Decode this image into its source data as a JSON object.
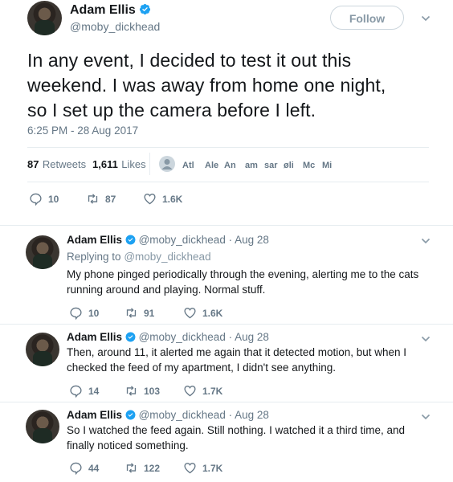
{
  "main_tweet": {
    "name": "Adam Ellis",
    "handle": "@moby_dickhead",
    "follow_label": "Follow",
    "text_lines": [
      "In any event, I decided to test it out this",
      "weekend. I was away from home one night,",
      "so I set up the camera before I left."
    ],
    "timestamp": "6:25 PM - 28 Aug 2017",
    "retweets_count": "87",
    "retweets_label": "Retweets",
    "likes_count": "1,611",
    "likes_label": "Likes",
    "likers": [
      "Atl",
      "Ale",
      "An",
      "am",
      "sar",
      "øli",
      "Mc",
      "Mi"
    ],
    "actions": {
      "replies": "10",
      "retweets": "87",
      "likes": "1.6K"
    }
  },
  "replies": [
    {
      "name": "Adam Ellis",
      "handle": "@moby_dickhead",
      "date": "· Aug 28",
      "replying_to_label": "Replying to",
      "replying_to_handle": "@moby_dickhead",
      "lines": [
        "My phone pinged periodically through the evening, alerting me to the cats",
        "running around and playing. Normal stuff."
      ],
      "actions": {
        "replies": "10",
        "retweets": "91",
        "likes": "1.6K"
      }
    },
    {
      "name": "Adam Ellis",
      "handle": "@moby_dickhead",
      "date": "· Aug 28",
      "lines": [
        "Then, around 11, it alerted me again that it detected motion, but when I",
        "checked the feed of my apartment, I didn't see anything."
      ],
      "actions": {
        "replies": "14",
        "retweets": "103",
        "likes": "1.7K"
      }
    },
    {
      "name": "Adam Ellis",
      "handle": "@moby_dickhead",
      "date": "· Aug 28",
      "lines": [
        "So I watched the feed again. Still nothing. I watched it a third time, and",
        "finally noticed something."
      ],
      "actions": {
        "replies": "44",
        "retweets": "122",
        "likes": "1.7K"
      }
    }
  ],
  "colors": {
    "verified": "#1da1f2",
    "muted": "#657786",
    "divider": "#e6ecf0"
  }
}
